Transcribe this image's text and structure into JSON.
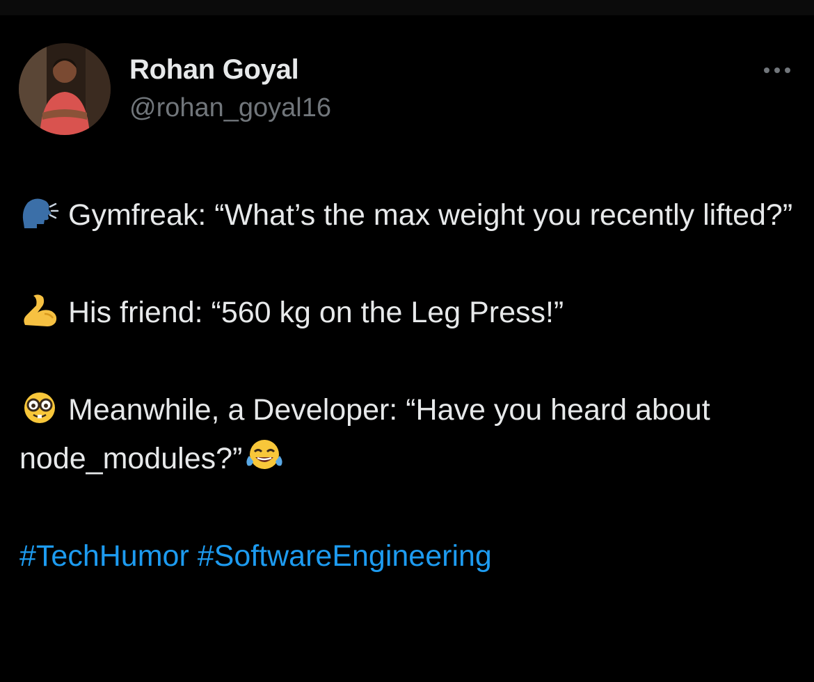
{
  "author": {
    "name": "Rohan Goyal",
    "handle": "@rohan_goyal16"
  },
  "icons": {
    "more": "more-horizontal-icon",
    "speaking_head": "speaking-head-icon",
    "flexed_biceps": "flexed-biceps-icon",
    "nerd_face": "nerd-face-icon",
    "tears_of_joy": "face-with-tears-of-joy-icon"
  },
  "tweet": {
    "line1_text": "Gymfreak: “What’s the max weight you recently lifted?”",
    "line2_text": "His friend: “560 kg on the Leg Press!”",
    "line3_text": "Meanwhile, a Developer: “Have you heard about node_modules?”",
    "hashtags": [
      "#TechHumor",
      "#SoftwareEngineering"
    ]
  },
  "colors": {
    "background": "#000000",
    "text": "#e7e9ea",
    "secondary": "#71767b",
    "link": "#1d9bf0"
  }
}
